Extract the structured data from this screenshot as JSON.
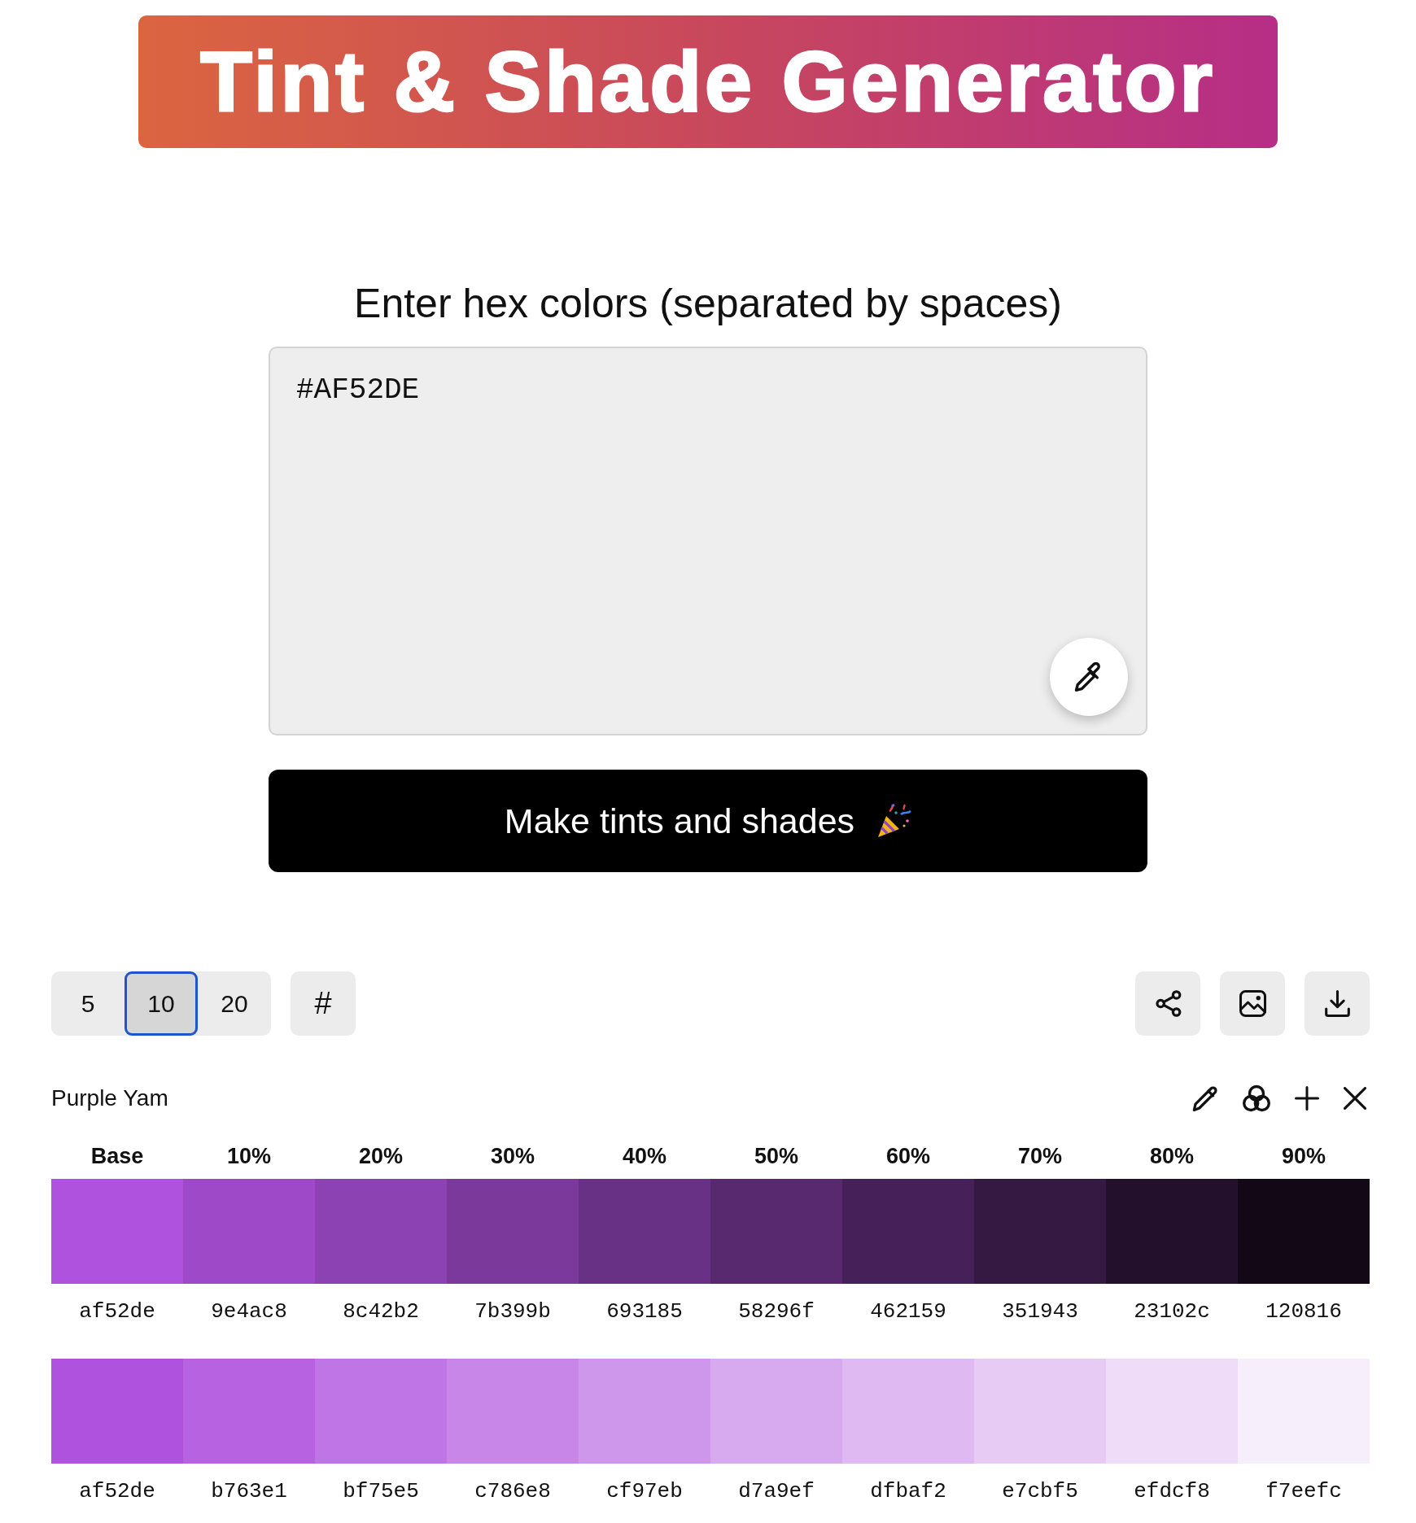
{
  "header": {
    "title": "Tint & Shade Generator"
  },
  "input": {
    "label": "Enter hex colors (separated by spaces)",
    "value": "#AF52DE"
  },
  "submit_button": {
    "label": "Make tints and shades"
  },
  "steps": [
    {
      "label": "5",
      "selected": false
    },
    {
      "label": "10",
      "selected": true
    },
    {
      "label": "20",
      "selected": false
    }
  ],
  "hash_button": {
    "label": "#"
  },
  "palette": {
    "name": "Purple Yam",
    "columns": [
      "Base",
      "10%",
      "20%",
      "30%",
      "40%",
      "50%",
      "60%",
      "70%",
      "80%",
      "90%"
    ],
    "shades": [
      {
        "hex": "af52de",
        "color": "#af52de"
      },
      {
        "hex": "9e4ac8",
        "color": "#9e4ac8"
      },
      {
        "hex": "8c42b2",
        "color": "#8c42b2"
      },
      {
        "hex": "7b399b",
        "color": "#7b399b"
      },
      {
        "hex": "693185",
        "color": "#693185"
      },
      {
        "hex": "58296f",
        "color": "#58296f"
      },
      {
        "hex": "462159",
        "color": "#462159"
      },
      {
        "hex": "351943",
        "color": "#351943"
      },
      {
        "hex": "23102c",
        "color": "#23102c"
      },
      {
        "hex": "120816",
        "color": "#120816"
      }
    ],
    "tints": [
      {
        "hex": "af52de",
        "color": "#af52de"
      },
      {
        "hex": "b763e1",
        "color": "#b763e1"
      },
      {
        "hex": "bf75e5",
        "color": "#bf75e5"
      },
      {
        "hex": "c786e8",
        "color": "#c786e8"
      },
      {
        "hex": "cf97eb",
        "color": "#cf97eb"
      },
      {
        "hex": "d7a9ef",
        "color": "#d7a9ef"
      },
      {
        "hex": "dfbaf2",
        "color": "#dfbaf2"
      },
      {
        "hex": "e7cbf5",
        "color": "#e7cbf5"
      },
      {
        "hex": "efdcf8",
        "color": "#efdcf8"
      },
      {
        "hex": "f7eefc",
        "color": "#f7eefc"
      }
    ]
  }
}
